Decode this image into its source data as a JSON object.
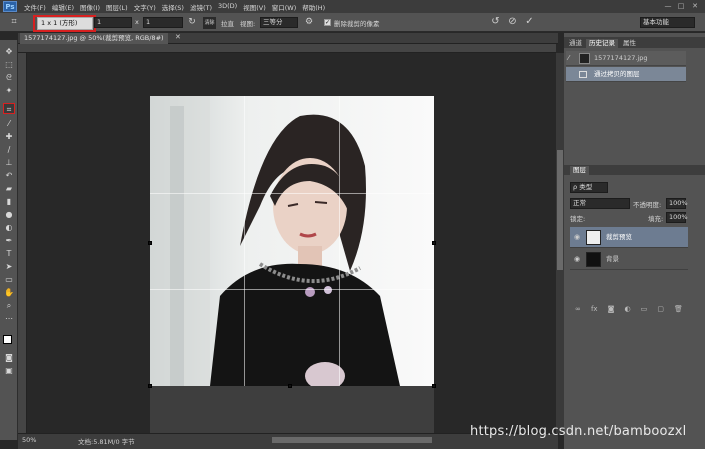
{
  "app": {
    "logo": "Ps"
  },
  "menu": [
    "文件(F)",
    "编辑(E)",
    "图像(I)",
    "图层(L)",
    "文字(Y)",
    "选择(S)",
    "滤镜(T)",
    "3D(D)",
    "视图(V)",
    "窗口(W)",
    "帮助(H)"
  ],
  "window_controls": {
    "minimize": "—",
    "maximize": "□",
    "close": "✕"
  },
  "options": {
    "ratio": "1 x 1 (方形)",
    "width": "1",
    "height": "1",
    "swap": "x",
    "clear": "清除",
    "straighten": "拉直",
    "view_label": "视图:",
    "view_value": "三等分",
    "delete_cropped": "删除裁剪的像素",
    "workspace": "基本功能"
  },
  "document": {
    "tab": "1577174127.jpg @ 50%(裁剪预览, RGB/8#)",
    "zoom": "50%",
    "doc_info": "文档:5.81M/0 字节"
  },
  "panels": {
    "tabs": [
      "通道",
      "历史记录",
      "属性"
    ],
    "history": [
      "1577174127.jpg",
      "通过拷贝的图层"
    ],
    "layers_title": "图层",
    "kind": "ρ 类型",
    "blend": "正常",
    "opacity_label": "不透明度:",
    "opacity_value": "100%",
    "lock_label": "锁定:",
    "fill_label": "填充:",
    "fill_value": "100%",
    "layers": [
      "裁剪预览",
      "背景"
    ]
  },
  "watermark": "https://blog.csdn.net/bamboozxl",
  "colors": {
    "highlight": "#d82020",
    "panel": "#535353",
    "canvas": "#282828"
  }
}
